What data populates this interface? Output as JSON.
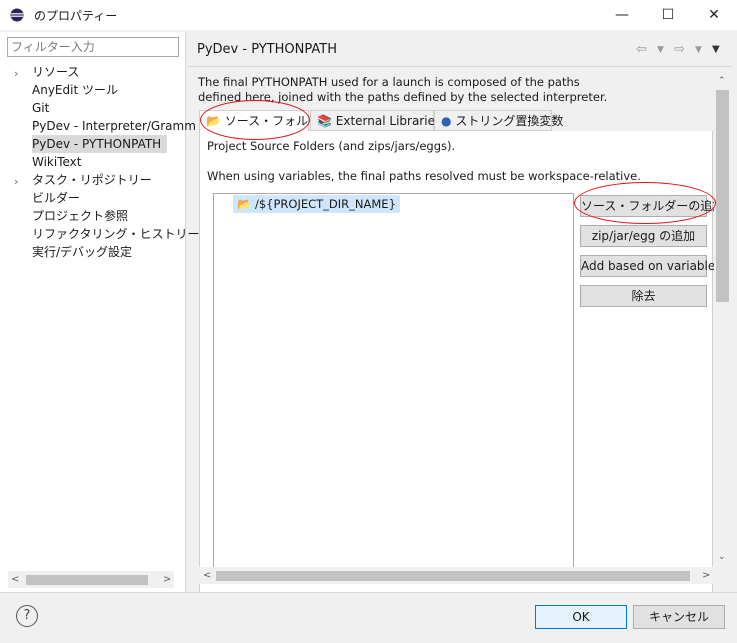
{
  "window": {
    "title": "のプロパティー",
    "minimize_glyph": "—",
    "maximize_glyph": "☐",
    "close_glyph": "✕"
  },
  "sidebar": {
    "filter_placeholder": "フィルター入力",
    "items": [
      {
        "label": "リソース",
        "expandable": true
      },
      {
        "label": "AnyEdit ツール",
        "expandable": false
      },
      {
        "label": "Git",
        "expandable": false
      },
      {
        "label": "PyDev - Interpreter/Gramm",
        "expandable": false
      },
      {
        "label": "PyDev - PYTHONPATH",
        "expandable": false,
        "selected": true
      },
      {
        "label": "WikiText",
        "expandable": false
      },
      {
        "label": "タスク・リポジトリー",
        "expandable": true
      },
      {
        "label": "ビルダー",
        "expandable": false
      },
      {
        "label": "プロジェクト参照",
        "expandable": false
      },
      {
        "label": "リファクタリング・ヒストリー",
        "expandable": false
      },
      {
        "label": "実行/デバッグ設定",
        "expandable": false
      }
    ]
  },
  "header": {
    "title": "PyDev - PYTHONPATH"
  },
  "content": {
    "description_line1": "The final PYTHONPATH used for a launch is composed of the paths",
    "description_line2": "defined here, joined with the paths defined by the selected interpreter.",
    "tabs": [
      {
        "label": "ソース・フォルダー",
        "active": true
      },
      {
        "label": "External Libraries",
        "active": false
      },
      {
        "label": "ストリング置換変数",
        "active": false
      }
    ],
    "info_line1": "Project Source Folders (and zips/jars/eggs).",
    "info_line2": "When using variables, the final paths resolved must be workspace-relative.",
    "folders": [
      "/${PROJECT_DIR_NAME}"
    ],
    "buttons": {
      "add_source_folder": "ソース・フォルダーの追加",
      "add_zip": "zip/jar/egg の追加",
      "add_variable": "Add based on variable",
      "remove": "除去"
    }
  },
  "footer": {
    "help": "?",
    "ok": "OK",
    "cancel": "キャンセル"
  },
  "colors": {
    "annotation": "#e01010",
    "selection": "#cfe6fc",
    "ok_border": "#0078d7"
  }
}
